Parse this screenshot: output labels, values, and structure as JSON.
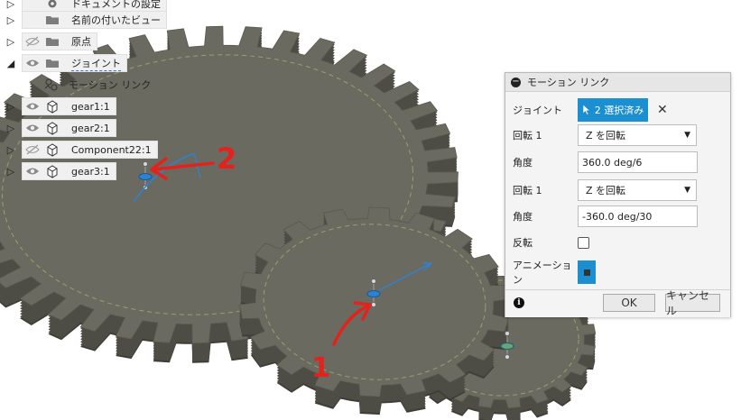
{
  "browser": {
    "items": [
      {
        "label": "ドキュメントの設定",
        "icon": "gear-icon",
        "visibility": "none",
        "expander": "collapsed"
      },
      {
        "label": "名前の付いたビュー",
        "icon": "folder-icon",
        "visibility": "none",
        "expander": "collapsed"
      },
      {
        "label": "原点",
        "icon": "folder-icon",
        "visibility": "hidden",
        "expander": "collapsed"
      },
      {
        "label": "ジョイント",
        "icon": "folder-icon",
        "visibility": "visible",
        "expander": "expanded"
      },
      {
        "label": "モーション リンク",
        "icon": "motion-link-icon",
        "visibility": "none",
        "expander": "none"
      },
      {
        "label": "gear1:1",
        "icon": "component-icon",
        "visibility": "visible",
        "expander": "collapsed"
      },
      {
        "label": "gear2:1",
        "icon": "component-icon",
        "visibility": "visible",
        "expander": "collapsed"
      },
      {
        "label": "Component22:1",
        "icon": "component-icon",
        "visibility": "hidden",
        "expander": "collapsed"
      },
      {
        "label": "gear3:1",
        "icon": "component-icon",
        "visibility": "visible",
        "expander": "collapsed"
      }
    ]
  },
  "dialog": {
    "title": "モーション リンク",
    "joint_label": "ジョイント",
    "joint_button": "2 選択済み",
    "rotation1_label": "回転 1",
    "rotation1_value": "Z を回転",
    "angle1_label": "角度",
    "angle1_value": "360.0 deg/6",
    "rotation2_label": "回転 1",
    "rotation2_value": "Z を回転",
    "angle2_label": "角度",
    "angle2_value": "-360.0 deg/30",
    "reverse_label": "反転",
    "reverse_checked": false,
    "animation_label": "アニメーション",
    "ok_label": "OK",
    "cancel_label": "キャンセル"
  },
  "annotations": {
    "label_1": "1",
    "label_2": "2",
    "color": "#e3231b"
  },
  "colors": {
    "accent": "#1b8fd0",
    "gear": "#6b6a60",
    "gear_dark": "#4e4d45",
    "gear_shadow": "#3e3d37"
  }
}
